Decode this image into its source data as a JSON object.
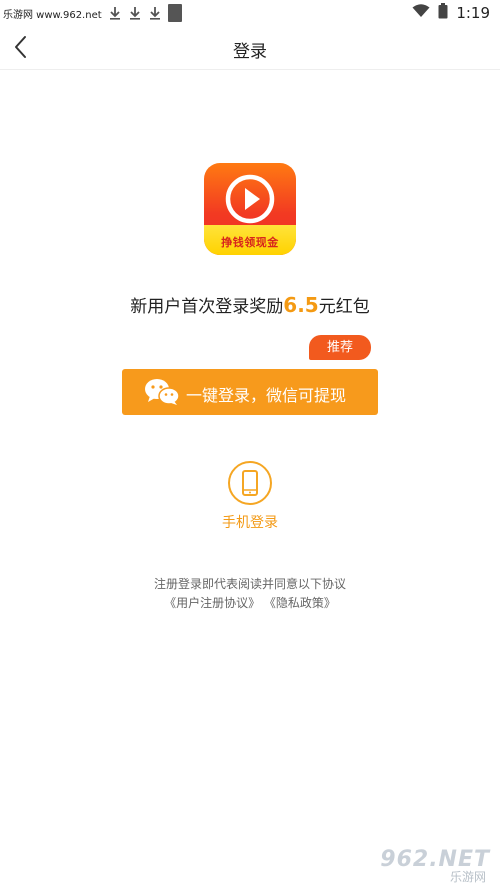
{
  "status_bar": {
    "watermark": "乐游网 www.962.net",
    "time": "1:19",
    "icons": [
      "download-arrow-icon",
      "download-arrow-icon",
      "download-arrow-icon",
      "notification-block-icon",
      "wifi-icon",
      "battery-icon"
    ]
  },
  "header": {
    "title": "登录",
    "back_icon": "chevron-left-icon"
  },
  "app_logo": {
    "ribbon_text": "挣钱领现金",
    "icon": "play-icon"
  },
  "reward": {
    "prefix": "新用户首次登录奖励",
    "amount": "6.5",
    "suffix": "元红包"
  },
  "recommend_badge": "推荐",
  "wechat_login": {
    "label": "一键登录，微信可提现",
    "icon": "wechat-icon"
  },
  "phone_login": {
    "label": "手机登录",
    "icon": "phone-icon"
  },
  "agreement": {
    "text": "注册登录即代表阅读并同意以下协议",
    "user_agreement": "《用户注册协议》",
    "privacy_policy": "《隐私政策》"
  },
  "watermark_bottom": {
    "big": "962.NET",
    "small": "乐游网"
  },
  "colors": {
    "accent_orange": "#f79a1c",
    "badge_red": "#f25a1e",
    "logo_red": "#ee2a2a",
    "logo_yellow": "#ffd200"
  }
}
